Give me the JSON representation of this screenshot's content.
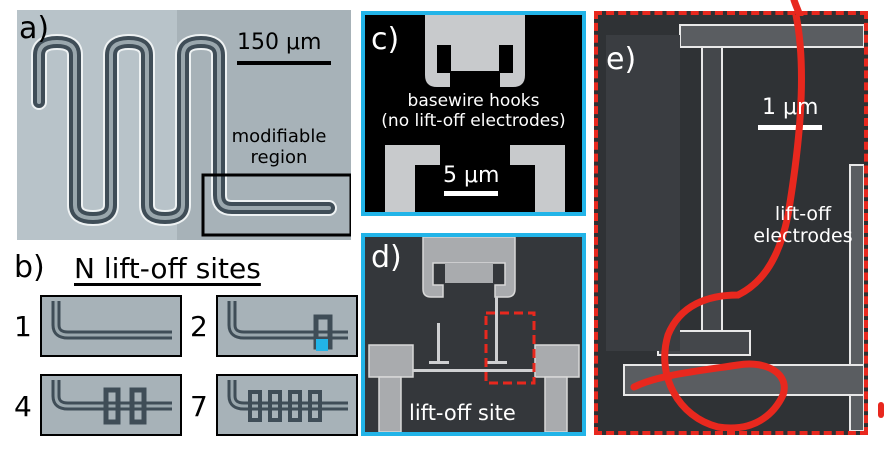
{
  "panels": {
    "a": {
      "letter": "a)",
      "scale_label": "150 μm",
      "region_label_line1": "modifiable",
      "region_label_line2": "region"
    },
    "b": {
      "letter": "b)",
      "title": "N lift-off sites",
      "sites": [
        "1",
        "2",
        "4",
        "7"
      ]
    },
    "c": {
      "letter": "c)",
      "caption_line1": "basewire hooks",
      "caption_line2": "(no lift-off electrodes)",
      "scale_label": "5 μm"
    },
    "d": {
      "letter": "d)",
      "caption": "lift-off site"
    },
    "e": {
      "letter": "e)",
      "scale_label": "1 μm",
      "caption_line1": "lift-off",
      "caption_line2": "electrodes"
    }
  },
  "colors": {
    "highlight_blue": "#22b4e8",
    "annotation_red": "#e8281e",
    "substrate": "#9aa7ad",
    "trace": "#3f4d57",
    "sem_bg": "#2d2f33"
  }
}
